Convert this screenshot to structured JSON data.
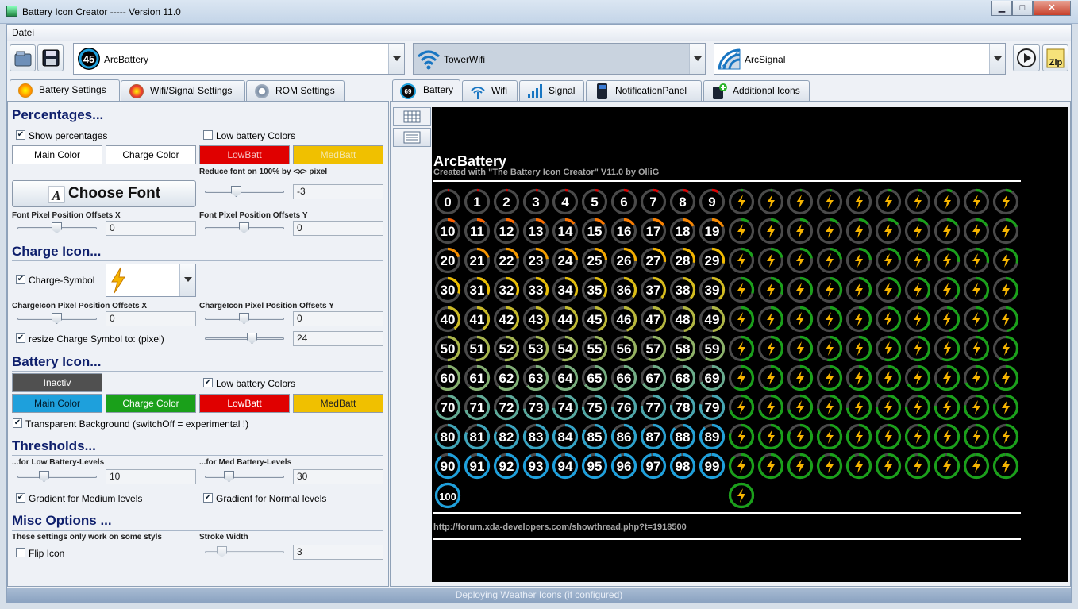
{
  "window": {
    "title": "Battery Icon Creator ----- Version 11.0",
    "minimize": "▁",
    "maximize": "□",
    "close": "✕"
  },
  "menu": {
    "file": "Datei"
  },
  "toolbar": {
    "open_icon": "open-icon",
    "save_icon": "save-icon",
    "play_icon": "play-icon",
    "zip_icon": "zip-icon",
    "zip_label": "Zip"
  },
  "selectors": {
    "battery": {
      "label": "ArcBattery",
      "badge": "45"
    },
    "wifi": {
      "label": "TowerWifi"
    },
    "signal": {
      "label": "ArcSignal"
    }
  },
  "left_tabs": [
    "Battery Settings",
    "Wifi/Signal Settings",
    "ROM Settings"
  ],
  "percentages": {
    "title": "Percentages...",
    "show_percentages": "Show percentages",
    "low_battery_colors": "Low battery Colors",
    "main_color": "Main Color",
    "charge_color": "Charge Color",
    "lowbatt": "LowBatt",
    "medbatt": "MedBatt",
    "reduce_font_label": "Reduce font on 100% by <x> pixel",
    "reduce_font_value": "-3",
    "choose_font": "Choose Font",
    "offset_x_label": "Font Pixel Position Offsets X",
    "offset_x_value": "0",
    "offset_y_label": "Font Pixel Position Offsets Y",
    "offset_y_value": "0"
  },
  "charge_icon": {
    "title": "Charge Icon...",
    "charge_symbol": "Charge-Symbol",
    "offset_x_label": "ChargeIcon Pixel Position Offsets X",
    "offset_x_value": "0",
    "offset_y_label": "ChargeIcon Pixel Position Offsets Y",
    "offset_y_value": "0",
    "resize_label": "resize Charge Symbol to: (pixel)",
    "resize_value": "24"
  },
  "battery_icon": {
    "title": "Battery Icon...",
    "inactiv": "Inactiv",
    "low_battery_colors": "Low battery Colors",
    "main_color": "Main Color",
    "charge_color": "Charge Color",
    "lowbatt": "LowBatt",
    "medbatt": "MedBatt",
    "transparent_bg": "Transparent Background (switchOff = experimental !)"
  },
  "thresholds": {
    "title": "Thresholds...",
    "low_label": "...for Low Battery-Levels",
    "low_value": "10",
    "med_label": "...for Med Battery-Levels",
    "med_value": "30",
    "gradient_medium": "Gradient for Medium levels",
    "gradient_normal": "Gradient for Normal levels"
  },
  "misc": {
    "title": "Misc Options ...",
    "note": "These settings only work on some styls",
    "stroke_label": "Stroke Width",
    "stroke_value": "3",
    "flip_icon": "Flip Icon"
  },
  "right_tabs": [
    {
      "label": "Battery",
      "badge": "69"
    },
    {
      "label": "Wifi"
    },
    {
      "label": "Signal"
    },
    {
      "label": "NotificationPanel"
    },
    {
      "label": "Additional Icons"
    }
  ],
  "preview": {
    "title": "ArcBattery",
    "subtitle": "Created with \"The Battery Icon Creator\" V11.0 by OlliG",
    "url": "http://forum.xda-developers.com/showthread.php?t=1918500",
    "levels_min": 0,
    "levels_max": 100,
    "low_threshold": 10,
    "med_threshold": 30
  },
  "colors": {
    "main": "#1ea0dc",
    "charge": "#1aa01a",
    "low": "#e00000",
    "med": "#f0c000",
    "inactiv": "#505050"
  },
  "status": {
    "text": "Deploying Weather Icons (if configured)"
  }
}
